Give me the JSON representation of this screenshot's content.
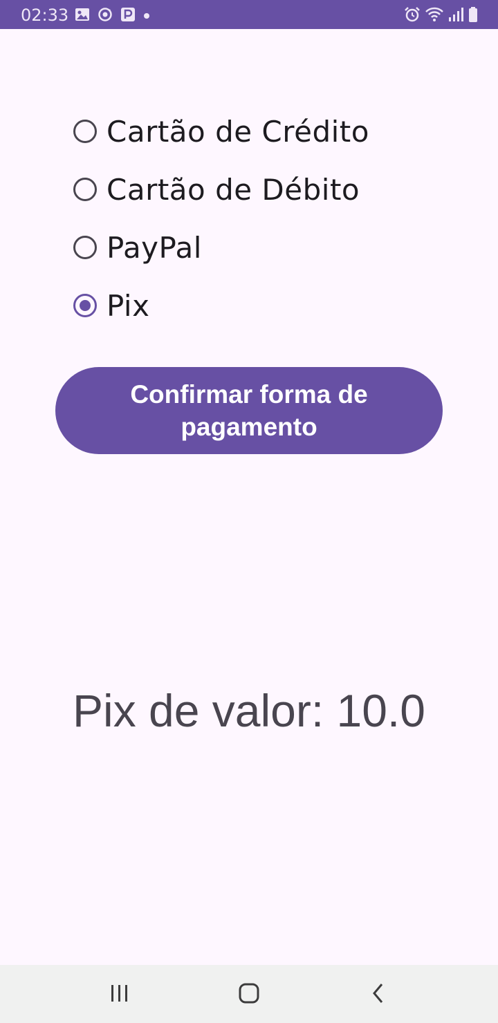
{
  "status_bar": {
    "time": "02:33",
    "background_color": "#6750A4",
    "left_icons": [
      "image-icon",
      "sync-icon",
      "parking-icon",
      "notification-dot-icon"
    ],
    "right_icons": [
      "alarm-icon",
      "wifi-icon",
      "signal-icon",
      "battery-icon"
    ]
  },
  "payment": {
    "options": [
      {
        "label": "Cartão de Crédito",
        "selected": false
      },
      {
        "label": "Cartão de Débito",
        "selected": false
      },
      {
        "label": "PayPal",
        "selected": false
      },
      {
        "label": "Pix",
        "selected": true
      }
    ],
    "accent_color": "#6750A4"
  },
  "confirm_button": {
    "label": "Confirmar forma de pagamento"
  },
  "result": {
    "text": "Pix de valor: 10.0"
  },
  "nav_bar": {
    "icons": [
      "recent-apps-icon",
      "home-icon",
      "back-icon"
    ]
  }
}
